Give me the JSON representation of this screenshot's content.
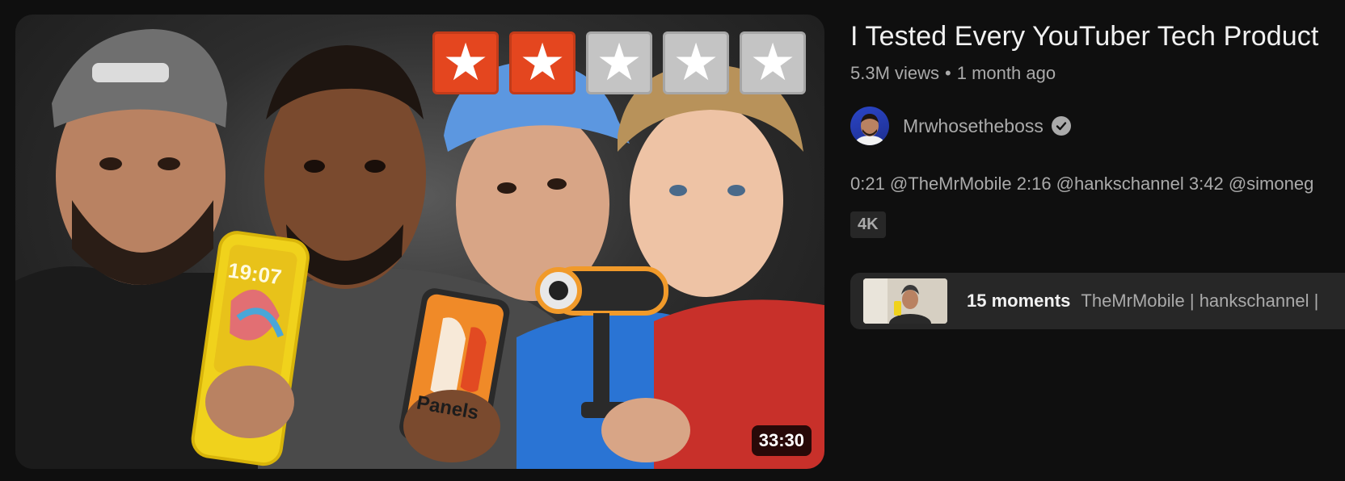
{
  "video": {
    "title": "I Tested Every YouTuber Tech Product",
    "views": "5.3M views",
    "separator": "•",
    "age": "1 month ago",
    "duration": "33:30",
    "channel": {
      "name": "Mrwhosetheboss",
      "verified": true
    },
    "description": "0:21 @TheMrMobile 2:16 @hankschannel 3:42 @simoneg",
    "badge": "4K",
    "rating_stars": {
      "filled": 2,
      "total": 5
    },
    "thumbnail_text": {
      "phone_time": "19:07",
      "panels_label": "Panels"
    },
    "moments": {
      "count_label": "15 moments",
      "names": "TheMrMobile | hankschannel |"
    }
  },
  "colors": {
    "background": "#0f0f0f",
    "star_on": "#e4461f",
    "star_off": "#c4c4c4",
    "secondary_text": "#aaaaaa",
    "chip_bg": "#272727"
  },
  "icons": [
    "star-icon",
    "verified-check-icon"
  ]
}
